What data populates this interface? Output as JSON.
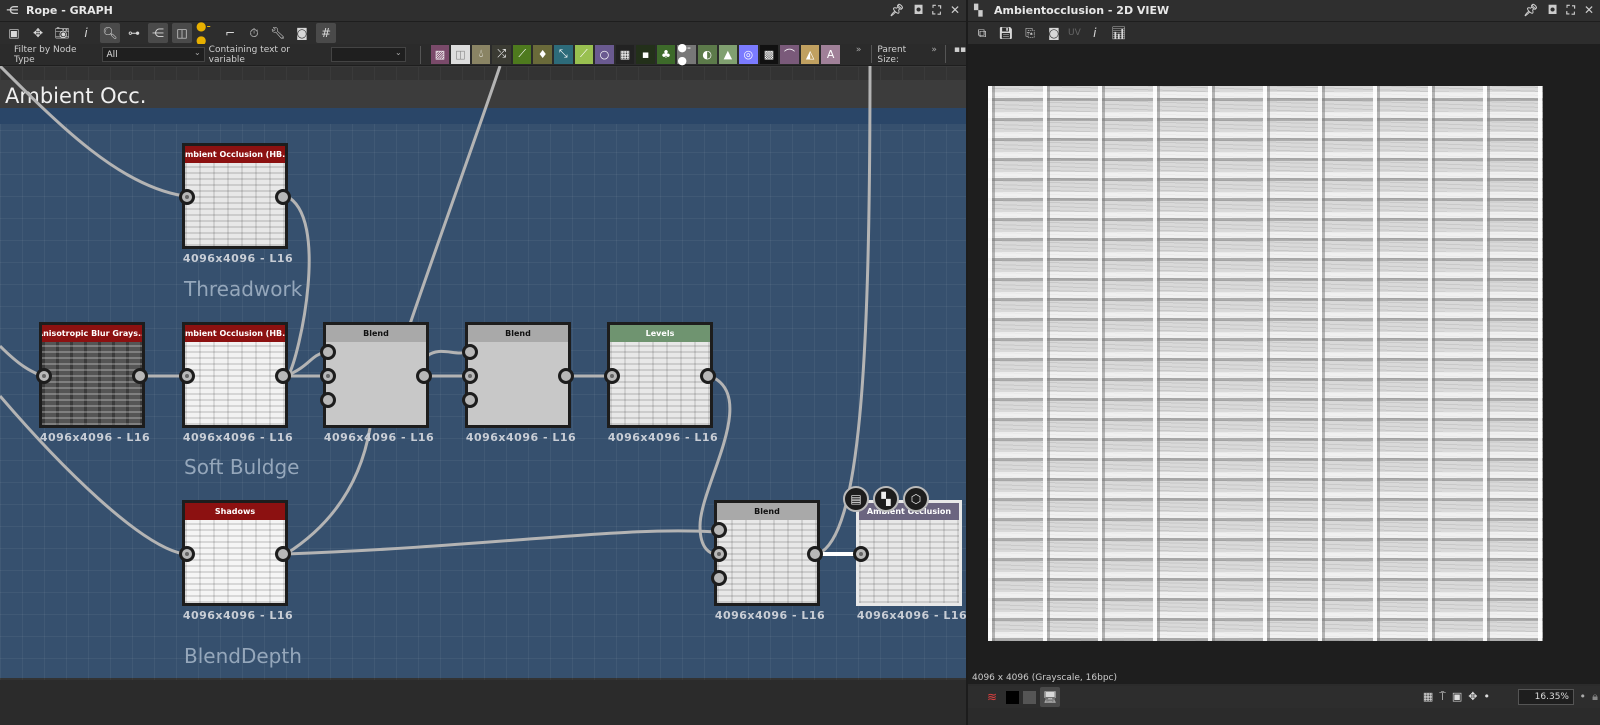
{
  "graph": {
    "title": "Rope - GRAPH",
    "filter_label": "Filter by Node Type",
    "filter_value": "All",
    "containing_label": "Containing text or variable",
    "containing_value": "",
    "parent_size_label": "Parent Size:",
    "more": "»",
    "frame_title": "Ambient Occ.",
    "comments": [
      "Threadwork",
      "Soft Buldge",
      "BlendDepth"
    ],
    "nodes": [
      {
        "title": "Ambient Occlusion (HB...",
        "res": "4096x4096 - L16"
      },
      {
        "title": "Anisotropic Blur Grays...",
        "res": "4096x4096 - L16"
      },
      {
        "title": "Ambient Occlusion (HB...",
        "res": "4096x4096 - L16"
      },
      {
        "title": "Blend",
        "res": "4096x4096 - L16"
      },
      {
        "title": "Blend",
        "res": "4096x4096 - L16"
      },
      {
        "title": "Levels",
        "res": "4096x4096 - L16"
      },
      {
        "title": "Shadows",
        "res": "4096x4096 - L16"
      },
      {
        "title": "Blend",
        "res": "4096x4096 - L16"
      },
      {
        "title": "Ambient Occlusion",
        "res": "4096x4096 - L16"
      }
    ]
  },
  "view": {
    "title": "Ambientocclusion - 2D VIEW",
    "uv_label": "UV",
    "status": "4096 x 4096 (Grayscale, 16bpc)",
    "zoom": "16.35%"
  },
  "colors": {
    "frame": "#36506e",
    "node_red": "#8c1111",
    "node_green": "#6f9470"
  }
}
